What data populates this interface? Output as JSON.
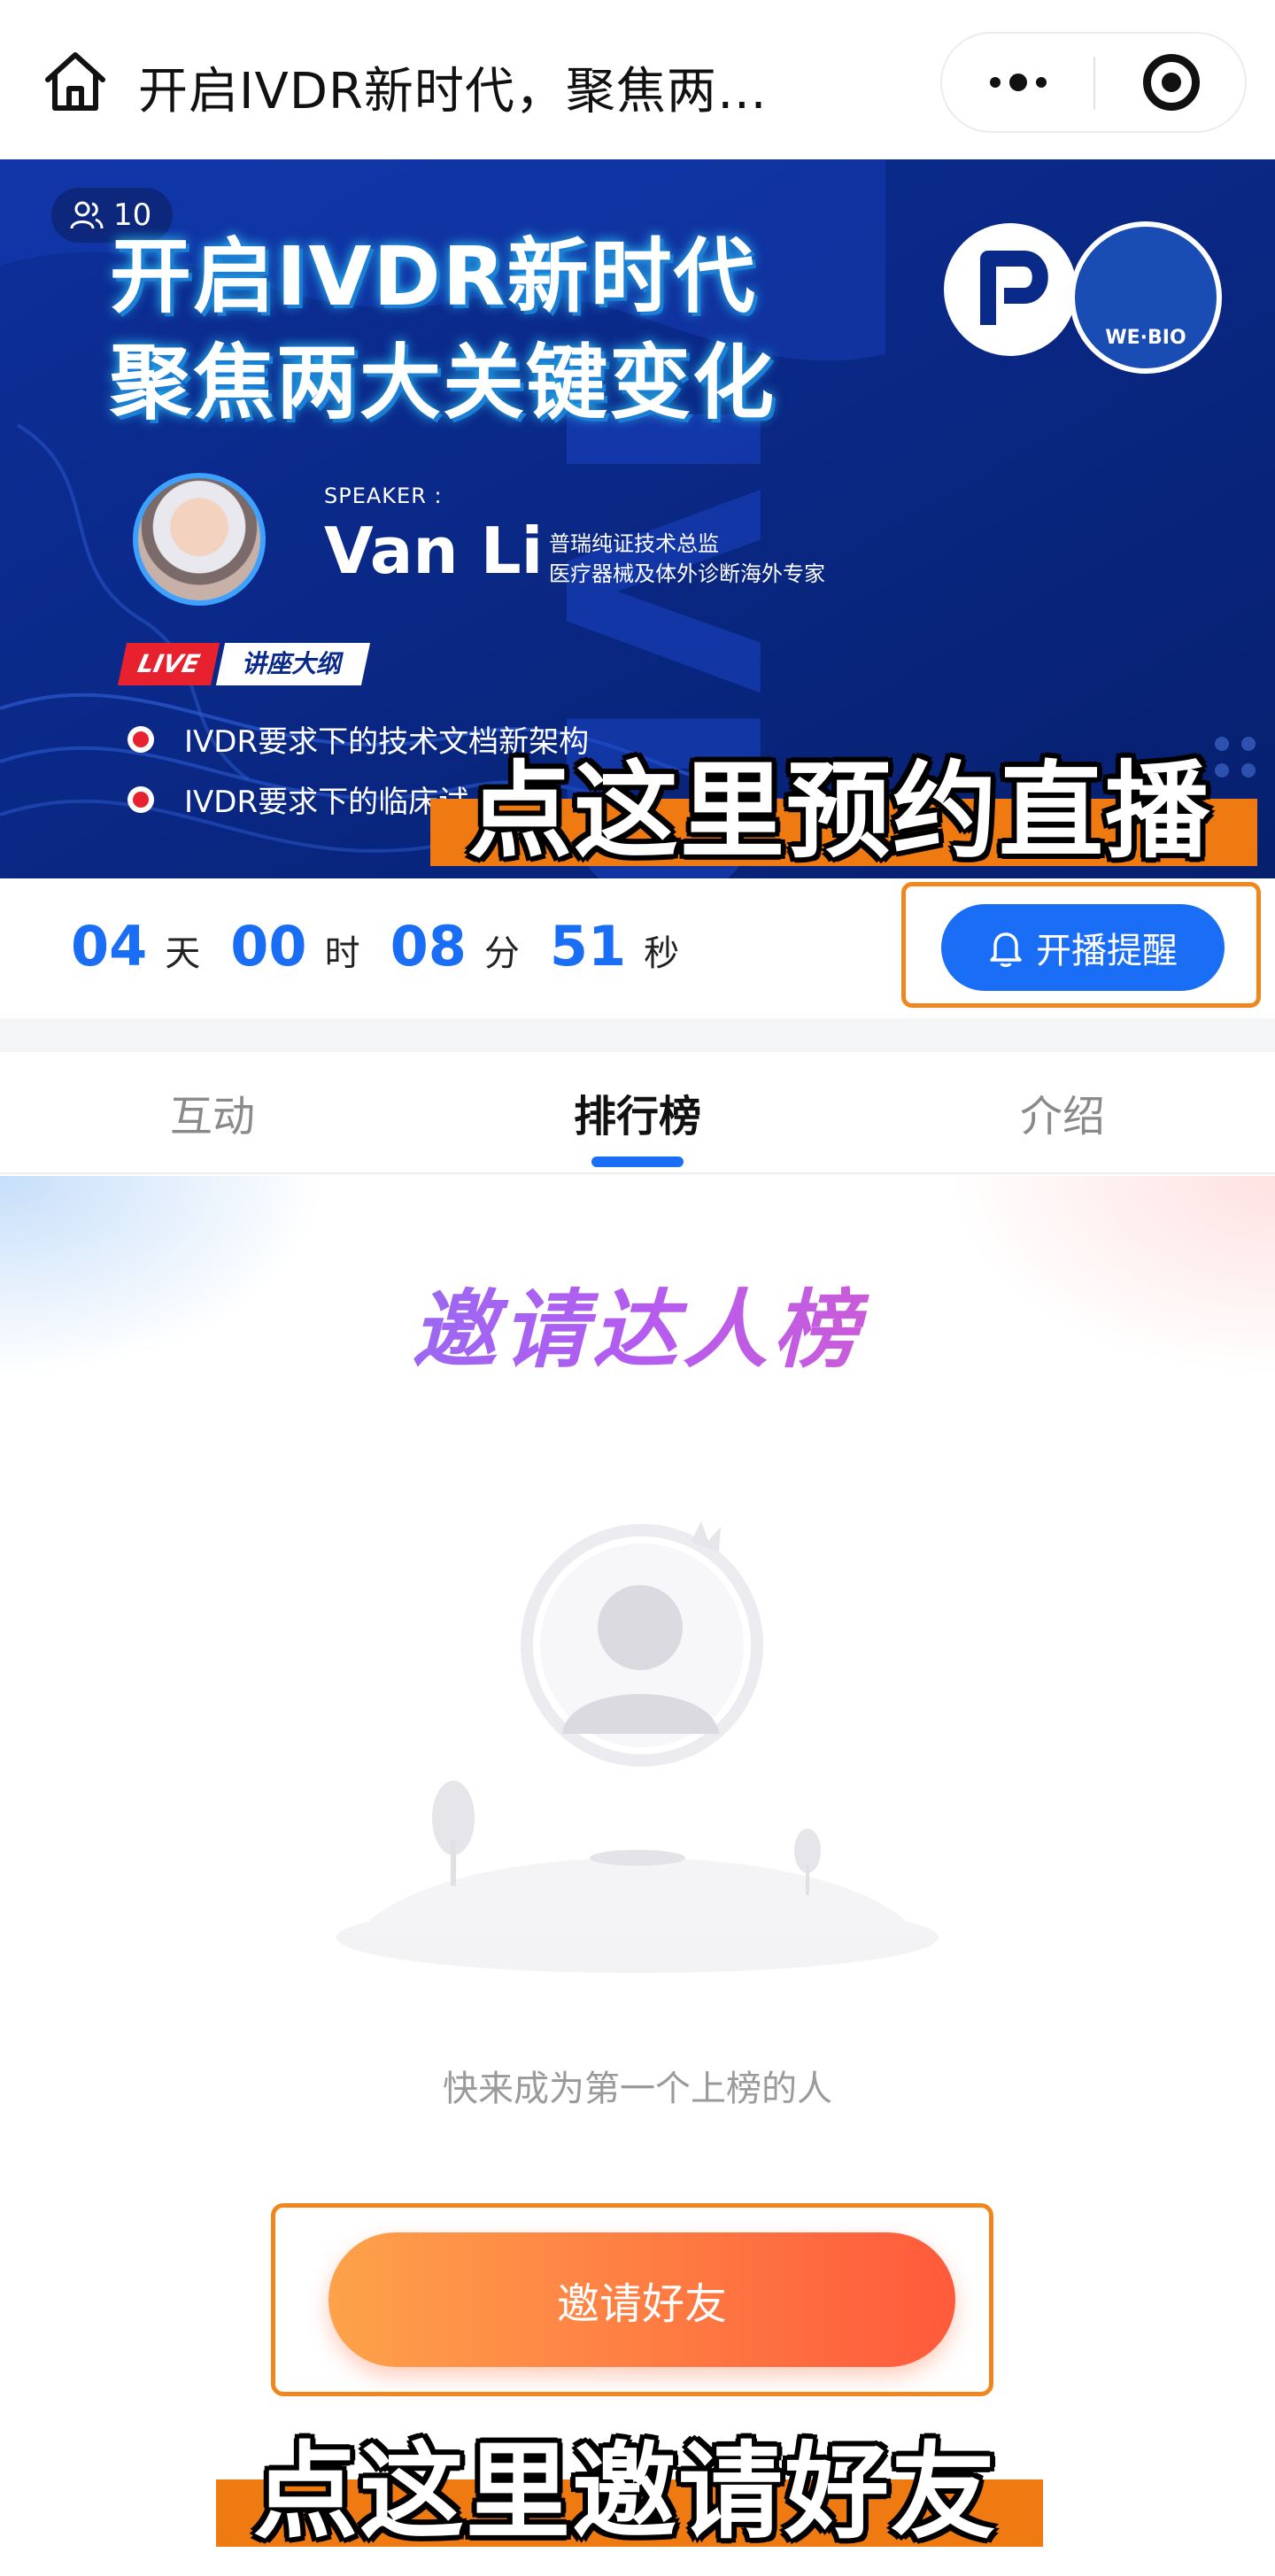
{
  "header": {
    "title": "开启IVDR新时代，聚焦两…",
    "home_icon": "home-icon",
    "more_icon": "more-dots-icon",
    "close_icon": "target-close-icon"
  },
  "banner": {
    "viewer_count": "10",
    "title_line1": "开启IVDR新时代",
    "title_line2": "聚焦两大关键变化",
    "speaker_label": "SPEAKER :",
    "speaker_name": "Van Li",
    "speaker_role1": "普瑞纯证技术总监",
    "speaker_role2": "医疗器械及体外诊断海外专家",
    "live_badge": "LIVE",
    "outline_label": "讲座大纲",
    "outline_items": [
      "IVDR要求下的技术文档新架构",
      "IVDR要求下的临床试"
    ],
    "logo_text": "WE·BIO"
  },
  "captions": {
    "top": "点这里预约直播",
    "bottom": "点这里邀请好友"
  },
  "countdown": {
    "days": "04",
    "days_unit": "天",
    "hours": "00",
    "hours_unit": "时",
    "minutes": "08",
    "minutes_unit": "分",
    "seconds": "51",
    "seconds_unit": "秒",
    "remind_label": "开播提醒"
  },
  "tabs": [
    {
      "label": "互动",
      "active": false
    },
    {
      "label": "排行榜",
      "active": true
    },
    {
      "label": "介绍",
      "active": false
    }
  ],
  "leaderboard": {
    "title": "邀请达人榜",
    "empty_text": "快来成为第一个上榜的人",
    "invite_label": "邀请好友"
  },
  "colors": {
    "accent_blue": "#1a6ef5",
    "highlight_orange": "#f0871e",
    "banner_navy": "#0a2a8a"
  }
}
